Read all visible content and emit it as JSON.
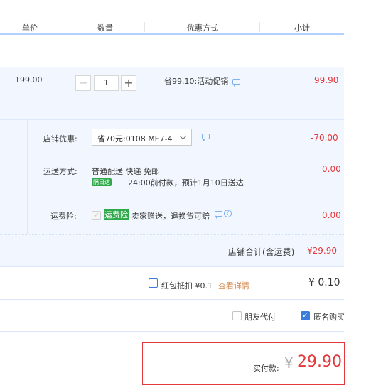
{
  "columns": [
    "单价",
    "数量",
    "优惠方式",
    "小计"
  ],
  "item": {
    "price": "199.00",
    "quantity": "1",
    "promo": "省99.10:活动促销",
    "subtotal": "99.90"
  },
  "shop_discount": {
    "label": "店铺优惠:",
    "selected": "省70元:0108 ME7-4",
    "amount": "-70.00"
  },
  "shipping": {
    "label": "运送方式:",
    "methods": "普通配送 快递 免邮",
    "badge": "隔日达",
    "detail": "24:00前付款，预计1月10日送达",
    "amount": "0.00"
  },
  "insurance": {
    "label": "运费险:",
    "tag": "运费险",
    "text": "卖家赠送，退换货可赔",
    "amount": "0.00"
  },
  "shop_total": {
    "label": "店铺合计(含运费)",
    "amount": "¥29.90"
  },
  "red_packet": {
    "label": "红包抵扣 ¥0.1",
    "link": "查看详情",
    "amount": "¥ 0.10"
  },
  "options": {
    "friend_pay": "朋友代付",
    "anonymous": "匿名购买"
  },
  "pay": {
    "label": "实付款:",
    "currency": "¥",
    "amount": "29.90"
  },
  "colors": {
    "accent": "#e4393c",
    "header_line": "#b2d1ff",
    "band": "#f2f7ff",
    "checkbox": "#3a7bdc",
    "badge_green": "#2ea84a"
  }
}
